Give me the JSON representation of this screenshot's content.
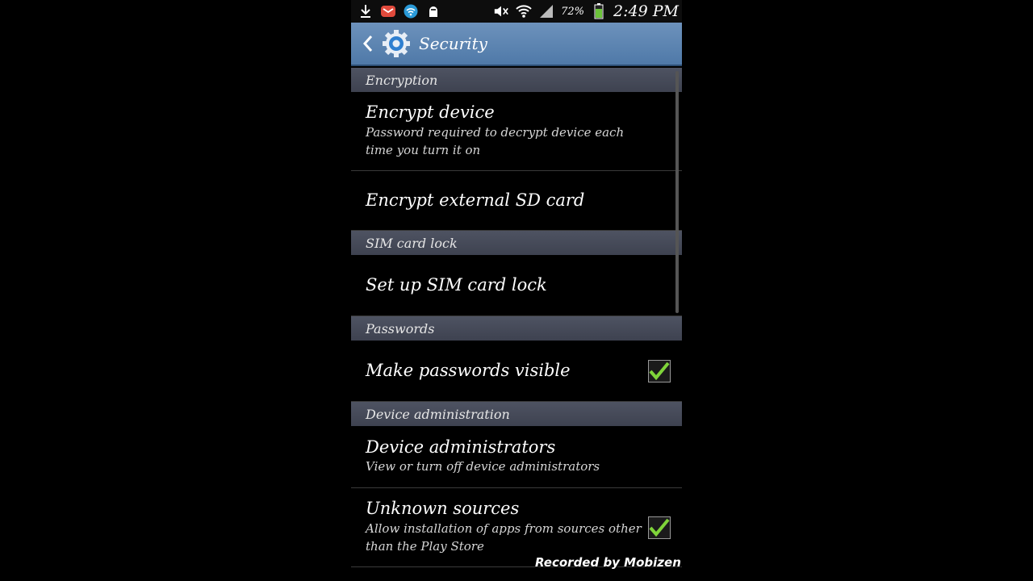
{
  "status_bar": {
    "battery": "72%",
    "time": "2:49 PM"
  },
  "action_bar": {
    "title": "Security"
  },
  "sections": {
    "encryption": "Encryption",
    "sim_card_lock": "SIM card lock",
    "passwords": "Passwords",
    "device_administration": "Device administration"
  },
  "items": {
    "encrypt_device": {
      "title": "Encrypt device",
      "summary": "Password required to decrypt device each time you turn it on"
    },
    "encrypt_sd": {
      "title": "Encrypt external SD card"
    },
    "sim_lock": {
      "title": "Set up SIM card lock"
    },
    "passwords_visible": {
      "title": "Make passwords visible",
      "checked": true
    },
    "device_admins": {
      "title": "Device administrators",
      "summary": "View or turn off device administrators"
    },
    "unknown_sources": {
      "title": "Unknown sources",
      "summary": "Allow installation of apps from sources other than the Play Store",
      "checked": true
    }
  },
  "watermark": "Recorded by Mobizen",
  "colors": {
    "action_bar": "#5a82b0",
    "section_header": "#474b59",
    "check_mark": "#7fd43a"
  }
}
